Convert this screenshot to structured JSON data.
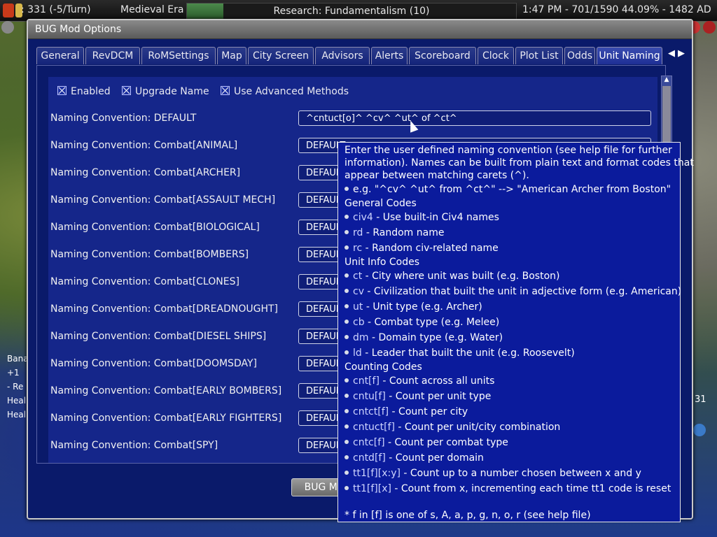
{
  "hud": {
    "gold": ": 331 (-5/Turn)",
    "era": "Medieval Era",
    "research": "Research: Fundamentalism (10)",
    "research_progress": 0.11,
    "status": "1:47 PM - 701/1590 44.09% - 1482 AD"
  },
  "dialog": {
    "title": "BUG Mod Options",
    "bottom_button": "BUG Mod"
  },
  "tabs": [
    "General",
    "RevDCM",
    "RoMSettings",
    "Map",
    "City Screen",
    "Advisors",
    "Alerts",
    "Scoreboard",
    "Clock",
    "Plot List",
    "Odds",
    "Unit Naming"
  ],
  "checkboxes": [
    {
      "label": "Enabled",
      "checked": true
    },
    {
      "label": "Upgrade Name",
      "checked": true
    },
    {
      "label": "Use Advanced Methods",
      "checked": true
    }
  ],
  "rows": [
    {
      "label": "Naming Convention: DEFAULT",
      "value": "^cntuct[o]^ ^cv^ ^ut^ of ^ct^"
    },
    {
      "label": "Naming Convention: Combat[ANIMAL]",
      "value": "DEFAULT"
    },
    {
      "label": "Naming Convention: Combat[ARCHER]",
      "value": "DEFAULT"
    },
    {
      "label": "Naming Convention: Combat[ASSAULT MECH]",
      "value": "DEFAULT"
    },
    {
      "label": "Naming Convention: Combat[BIOLOGICAL]",
      "value": "DEFAULT"
    },
    {
      "label": "Naming Convention: Combat[BOMBERS]",
      "value": "DEFAULT"
    },
    {
      "label": "Naming Convention: Combat[CLONES]",
      "value": "DEFAULT"
    },
    {
      "label": "Naming Convention: Combat[DREADNOUGHT]",
      "value": "DEFAULT"
    },
    {
      "label": "Naming Convention: Combat[DIESEL SHIPS]",
      "value": "DEFAULT"
    },
    {
      "label": "Naming Convention: Combat[DOOMSDAY]",
      "value": "DEFAULT"
    },
    {
      "label": "Naming Convention: Combat[EARLY BOMBERS]",
      "value": "DEFAULT"
    },
    {
      "label": "Naming Convention: Combat[EARLY FIGHTERS]",
      "value": "DEFAULT"
    },
    {
      "label": "Naming Convention: Combat[SPY]",
      "value": "DEFAULT"
    }
  ],
  "tooltip": {
    "intro1": "Enter the user defined naming convention (see help file for further",
    "intro2": "information). Names can be built from plain text and format codes that",
    "intro3": "appear between matching carets (^).",
    "example": "e.g. \"^cv^ ^ut^ from ^ct^\" --> \"American Archer from Boston\"",
    "general_header": "General Codes",
    "general": [
      {
        "code": "civ4",
        "desc": " - Use built-in Civ4 names"
      },
      {
        "code": "rd",
        "desc": " - Random name"
      },
      {
        "code": "rc",
        "desc": " - Random civ-related name"
      }
    ],
    "unit_header": "Unit Info Codes",
    "unit": [
      {
        "code": "ct",
        "desc": " - City where unit was built (e.g. Boston)"
      },
      {
        "code": "cv",
        "desc": " - Civilization that built the unit in adjective form (e.g. American)"
      },
      {
        "code": "ut",
        "desc": " - Unit type (e.g. Archer)"
      },
      {
        "code": "cb",
        "desc": " - Combat type (e.g. Melee)"
      },
      {
        "code": "dm",
        "desc": " - Domain type (e.g. Water)"
      },
      {
        "code": "ld",
        "desc": " - Leader that built the unit (e.g. Roosevelt)"
      }
    ],
    "counting_header": "Counting Codes",
    "counting": [
      {
        "code": "cnt[f]",
        "desc": " - Count across all units"
      },
      {
        "code": "cntu[f]",
        "desc": " - Count per unit type"
      },
      {
        "code": "cntct[f]",
        "desc": " - Count per city"
      },
      {
        "code": "cntuct[f]",
        "desc": " - Count per unit/city combination"
      },
      {
        "code": "cntc[f]",
        "desc": " - Count per combat type"
      },
      {
        "code": "cntd[f]",
        "desc": " - Count per domain"
      },
      {
        "code": "tt1[f][x:y]",
        "desc": " - Count up to a number chosen between x and y"
      },
      {
        "code": "tt1[f][x]",
        "desc": " - Count from x, incrementing each time tt1 code is reset"
      }
    ],
    "footnote": "* f in [f] is one of s, A, a, p, g, n, o, r (see help file)"
  },
  "edge": {
    "left_text": [
      "Bana",
      "+1",
      "- Re",
      "Heal",
      "Heal"
    ],
    "right_text": "31"
  }
}
